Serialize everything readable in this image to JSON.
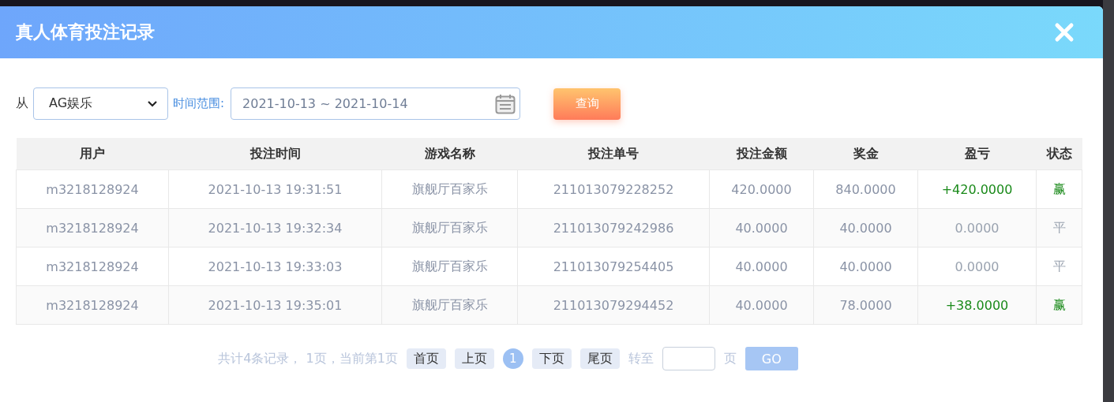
{
  "window": {
    "title": "真人体育投注记录"
  },
  "filter": {
    "from_label": "从",
    "platform": "AG娱乐",
    "range_label": "时间范围:",
    "date_range": "2021-10-13 ~ 2021-10-14",
    "query_button": "查询"
  },
  "table": {
    "columns": [
      "用户",
      "投注时间",
      "游戏名称",
      "投注单号",
      "投注金额",
      "奖金",
      "盈亏",
      "状态"
    ],
    "rows": [
      {
        "kind": "win",
        "cells": [
          "m3218128924",
          "2021-10-13 19:31:51",
          "旗舰厅百家乐",
          "211013079228252",
          "420.0000",
          "840.0000",
          "+420.0000",
          "赢"
        ]
      },
      {
        "kind": "draw",
        "cells": [
          "m3218128924",
          "2021-10-13 19:32:34",
          "旗舰厅百家乐",
          "211013079242986",
          "40.0000",
          "40.0000",
          "0.0000",
          "平"
        ]
      },
      {
        "kind": "draw",
        "cells": [
          "m3218128924",
          "2021-10-13 19:33:03",
          "旗舰厅百家乐",
          "211013079254405",
          "40.0000",
          "40.0000",
          "0.0000",
          "平"
        ]
      },
      {
        "kind": "win",
        "cells": [
          "m3218128924",
          "2021-10-13 19:35:01",
          "旗舰厅百家乐",
          "211013079294452",
          "40.0000",
          "78.0000",
          "+38.0000",
          "赢"
        ]
      }
    ]
  },
  "pagination": {
    "summary": "共计4条记录， 1页，当前第1页",
    "buttons": [
      "首页",
      "上页"
    ],
    "pages": [
      {
        "label": "1",
        "selected": true
      }
    ],
    "buttons_after": [
      "下页",
      "尾页"
    ],
    "goto_label": "转至",
    "page_unit": "页",
    "go_button": "GO"
  }
}
